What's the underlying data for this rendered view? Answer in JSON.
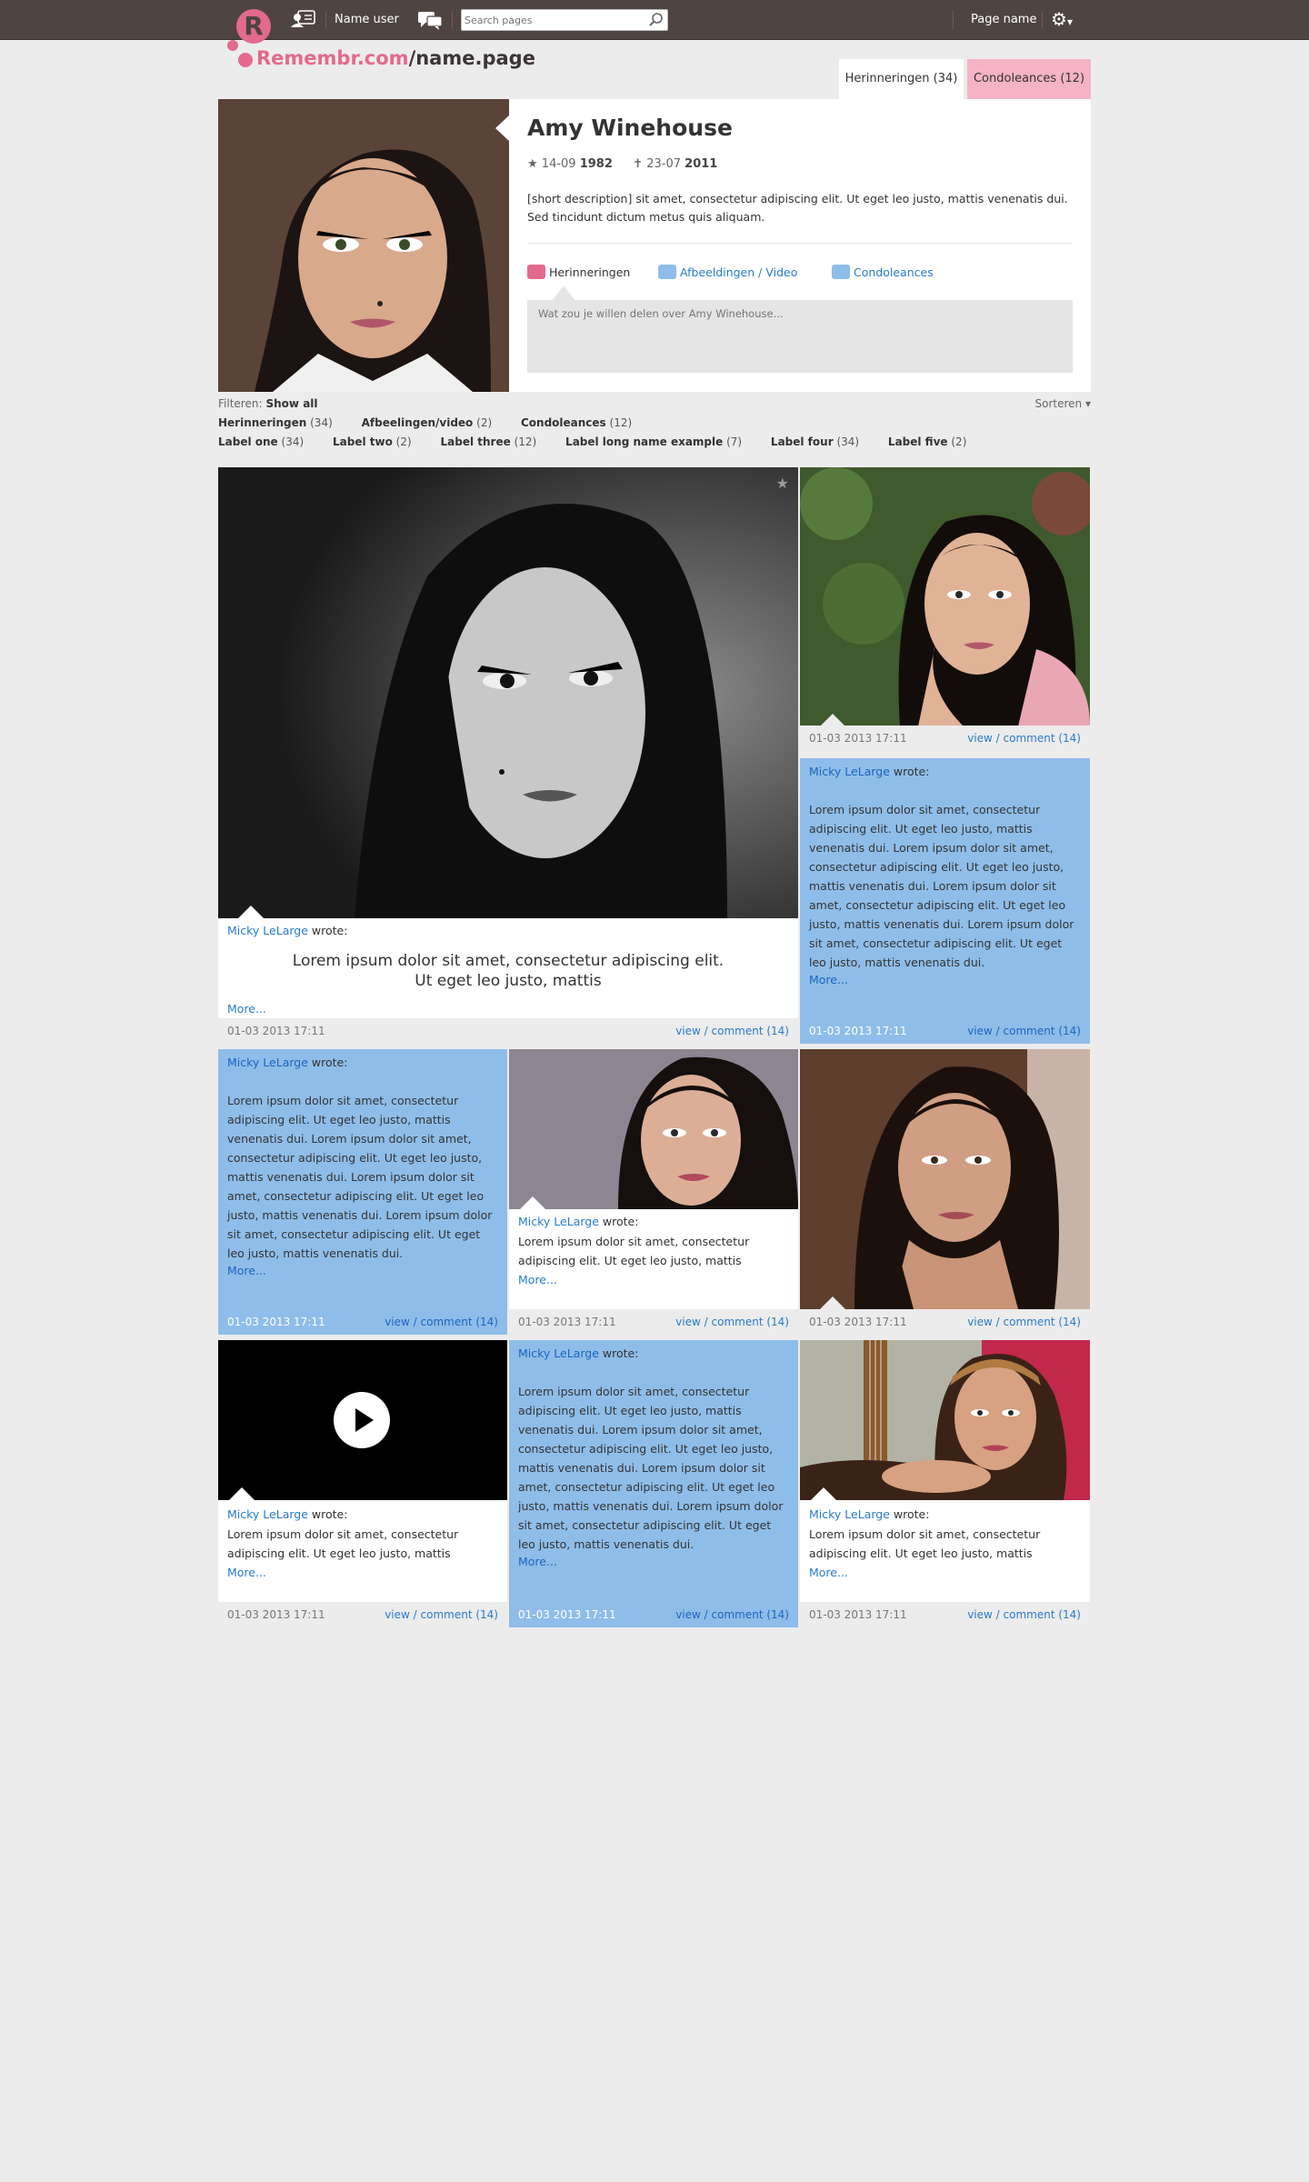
{
  "topbar": {
    "logo_letter": "R",
    "user_name": "Name user",
    "search_placeholder": "Search pages",
    "page_name": "Page name",
    "settings_icon": "gear-icon",
    "settings_caret": "▾"
  },
  "brand": {
    "domain": "Remembr.com",
    "slash": "/",
    "page": "name.page"
  },
  "tabs": [
    {
      "label": "Herinneringen (34)"
    },
    {
      "label": "Condoleances (12)"
    }
  ],
  "profile": {
    "name": "Amy Winehouse",
    "birth_day": "14-09",
    "birth_year": "1982",
    "death_day": "23-07",
    "death_year": "2011",
    "description": "[short description] sit amet, consectetur adipiscing elit. Ut eget leo justo, mattis venenatis dui. Sed tincidunt dictum metus quis aliquam.",
    "post_tabs": [
      {
        "label": "Herinneringen"
      },
      {
        "label": "Afbeeldingen / Video"
      },
      {
        "label": "Condoleances"
      }
    ],
    "share_placeholder": "Wat zou je willen delen over Amy Winehouse..."
  },
  "filters": {
    "label": "Filteren:",
    "current": "Show all",
    "sort": "Sorteren ▾",
    "types": [
      {
        "name": "Herinneringen",
        "count": "(34)"
      },
      {
        "name": "Afbeelingen/video",
        "count": "(2)"
      },
      {
        "name": "Condoleances",
        "count": "(12)"
      }
    ],
    "labels": [
      {
        "name": "Label one",
        "count": "(34)"
      },
      {
        "name": "Label two",
        "count": "(2)"
      },
      {
        "name": "Label three",
        "count": "(12)"
      },
      {
        "name": "Label long name example",
        "count": "(7)"
      },
      {
        "name": "Label four",
        "count": "(34)"
      },
      {
        "name": "Label five",
        "count": "(2)"
      }
    ]
  },
  "cards": {
    "author": "Micky LeLarge",
    "wrote": "wrote:",
    "more": "More...",
    "date": "01-03 2013 17:11",
    "view": "view",
    "sep": "/",
    "comment": "comment (14)",
    "big_text_1": "Lorem ipsum dolor sit amet, consectetur adipiscing elit.",
    "big_text_2": "Ut eget leo justo, mattis",
    "short_text": "Lorem ipsum dolor sit amet, consectetur adipiscing elit. Ut eget leo justo, mattis",
    "long_text": "Lorem ipsum dolor sit amet, consectetur adipiscing elit. Ut eget leo justo, mattis venenatis dui.  Lorem ipsum dolor sit amet, consectetur adipiscing elit. Ut eget leo justo, mattis venenatis dui. Lorem ipsum dolor sit amet, consectetur adipiscing elit. Ut eget leo justo, mattis venenatis dui. Lorem ipsum dolor sit amet, consectetur adipiscing elit. Ut eget leo justo, mattis venenatis dui."
  },
  "colors": {
    "topbar": "#4f4442",
    "pink": "#e36a8d",
    "blue_card": "#8fbde9",
    "link": "#2a7bc8"
  }
}
